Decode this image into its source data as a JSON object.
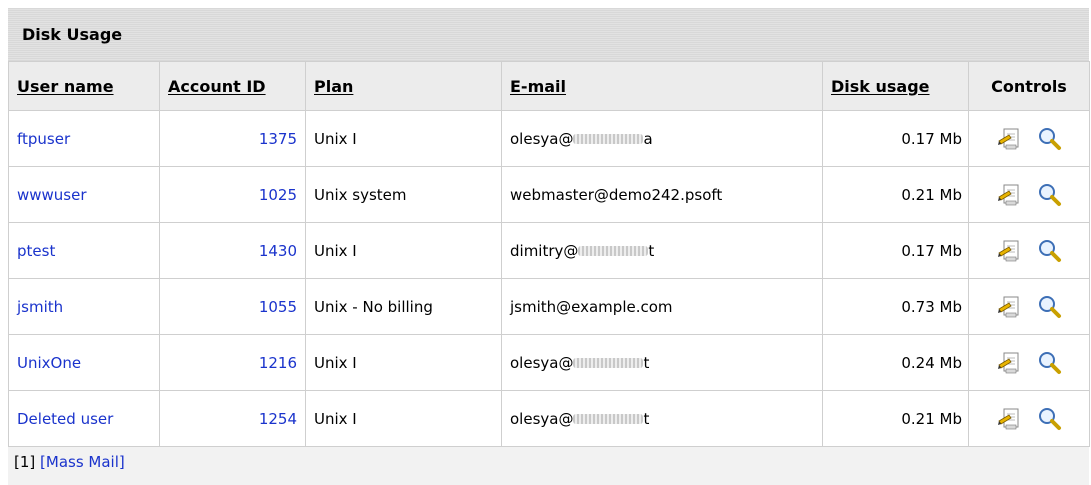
{
  "panel": {
    "title": "Disk Usage"
  },
  "columns": {
    "user_name": "User name",
    "account_id": "Account ID",
    "plan": "Plan",
    "email": "E-mail",
    "disk_usage": "Disk usage",
    "controls": "Controls"
  },
  "rows": [
    {
      "user": "ftpuser",
      "account": "1375",
      "plan": "Unix I",
      "email_prefix": "olesya@",
      "email_suffix": "a",
      "email_obscured": true,
      "usage": "0.17 Mb"
    },
    {
      "user": "wwwuser",
      "account": "1025",
      "plan": "Unix system",
      "email_prefix": "webmaster@demo242.psoft",
      "email_suffix": "",
      "email_obscured": false,
      "usage": "0.21 Mb"
    },
    {
      "user": "ptest",
      "account": "1430",
      "plan": "Unix I",
      "email_prefix": "dimitry@",
      "email_suffix": "t",
      "email_obscured": true,
      "usage": "0.17 Mb"
    },
    {
      "user": "jsmith",
      "account": "1055",
      "plan": "Unix - No billing",
      "email_prefix": "jsmith@example.com",
      "email_suffix": "",
      "email_obscured": false,
      "usage": "0.73 Mb"
    },
    {
      "user": "UnixOne",
      "account": "1216",
      "plan": "Unix I",
      "email_prefix": "olesya@",
      "email_suffix": "t",
      "email_obscured": true,
      "usage": "0.24 Mb"
    },
    {
      "user": "Deleted user",
      "account": "1254",
      "plan": "Unix I",
      "email_prefix": "olesya@",
      "email_suffix": "t",
      "email_obscured": true,
      "usage": "0.21 Mb"
    }
  ],
  "controls_icons": [
    "edit-icon",
    "search-icon"
  ],
  "footer": {
    "page": "[1]",
    "mass_mail": "[Mass Mail]"
  }
}
